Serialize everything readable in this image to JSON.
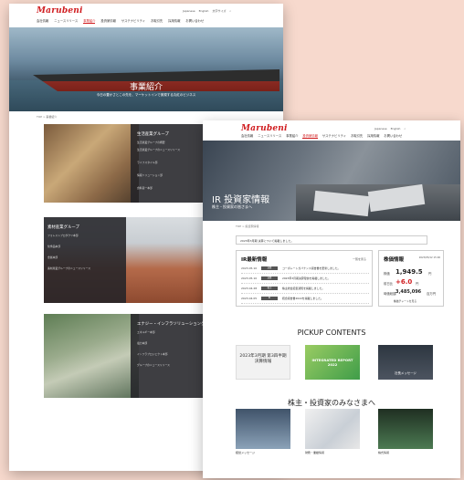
{
  "brand": {
    "logo": "Marubeni",
    "accent": "#d01c1f"
  },
  "back": {
    "nav": [
      "会社情報",
      "ニュースリリース",
      "事業紹介",
      "投資家情報",
      "サステナビリティ",
      "お取引先",
      "採用情報",
      "お問い合わせ"
    ],
    "active_nav": 2,
    "utils": [
      "Japanese",
      "English",
      "文字サイズ"
    ],
    "hero_title": "事業紹介",
    "hero_sub": "今日の豊かさとこの先を、マーケットインで実現する丸紅のビジネス",
    "breadcrumb": "TOP > 事業紹介",
    "sections": [
      {
        "title": "生活産業グループ",
        "links": [
          "生活産業グループの概要",
          "生活産業グループのニュースリリース",
          "ライフスタイル部",
          "情報ソリューション部",
          "食料第一本部"
        ]
      },
      {
        "title": "素材産業グループ",
        "links": [
          "フォレストプロダクツ本部",
          "化学品本部",
          "金属本部",
          "素材産業グループのニュースリリース"
        ]
      },
      {
        "title": "エナジー・インフラソリューショングループ",
        "links": [
          "エネルギー本部",
          "電力本部",
          "インフラプロジェクト本部",
          "グループのニュースリリース"
        ]
      }
    ]
  },
  "front": {
    "nav": [
      "会社情報",
      "ニュースリリース",
      "事業紹介",
      "投資家情報",
      "サステナビリティ",
      "お取引先",
      "採用情報",
      "お問い合わせ"
    ],
    "active_nav": 3,
    "utils": [
      "Japanese",
      "English"
    ],
    "hero_title": "IR 投資家情報",
    "hero_sub": "株主・投資家の皆さまへ",
    "breadcrumb": "TOP > 投資家情報",
    "notice": "2023年3月期 決算について掲載しました。",
    "news_title": "IR最新情報",
    "news_more": "一覧を見る",
    "news": [
      {
        "date": "2023.05.10",
        "tag": "決算",
        "text": "コーポレートガバナンス報告書を更新しました。"
      },
      {
        "date": "2023.05.10",
        "tag": "決算",
        "text": "2023年3月期決算短信を掲載しました。"
      },
      {
        "date": "2023.04.28",
        "tag": "株主",
        "text": "株主総会招集通知を掲載しました。"
      },
      {
        "date": "2023.04.05",
        "tag": "IR",
        "text": "統合報告書2022を掲載しました。"
      }
    ],
    "stock_title": "株価情報",
    "stock_date": "2023/05/12 15:00",
    "stock": [
      {
        "k": "株価",
        "v": "1,949.5",
        "u": "円"
      },
      {
        "k": "前日比",
        "v": "+6.0",
        "u": "円"
      },
      {
        "k": "時価総額",
        "v": "3,485,096",
        "u": "百万円"
      }
    ],
    "stock_link": "株価チャートを見る",
    "pickup_title": "PICKUP CONTENTS",
    "pickup": [
      "2023年3月期 第3四半期決算情報",
      "INTEGRATED REPORT 2022",
      "社長メッセージ"
    ],
    "investors_title": "株主・投資家のみなさまへ",
    "investors": [
      "経営メッセージ",
      "財務・業績情報",
      "株式情報"
    ]
  }
}
